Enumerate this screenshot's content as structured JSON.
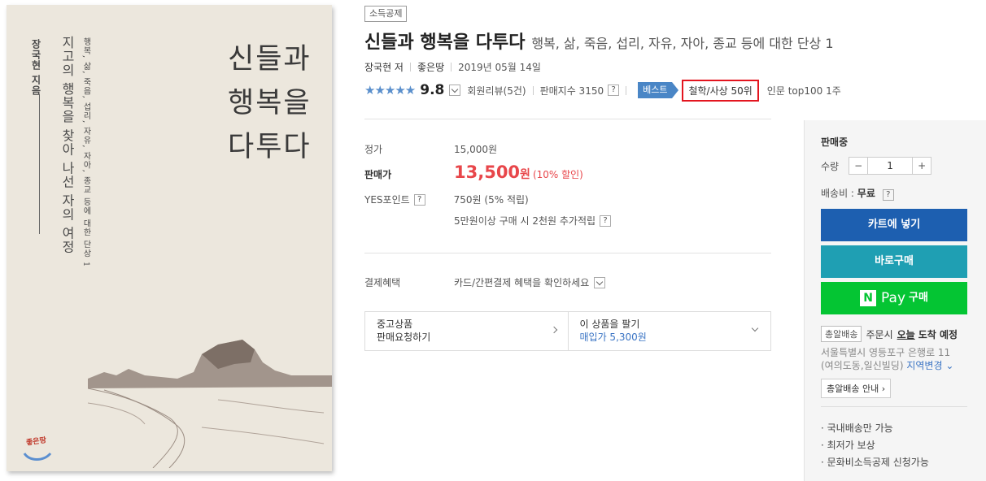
{
  "cover": {
    "title_lines": [
      "신들과",
      "행복을",
      "다투다"
    ],
    "author": "장국현 지음",
    "subtitle": "지고의 행복을 찾아 나선 자의 여정",
    "subtitle2": "행복, 삶, 죽음, 섭리, 자유, 자아, 종교 등에 대한 단상 1",
    "publisher_logo": "좋은땅"
  },
  "tag": "소득공제",
  "title": {
    "main": "신들과 행복을 다투다",
    "sub": "행복, 삶, 죽음, 섭리, 자유, 자아, 종교 등에 대한 단상 1"
  },
  "meta": {
    "author": "장국현 저",
    "publisher": "좋은땅",
    "date": "2019년 05월 14일"
  },
  "rating": {
    "stars": "★★★★★",
    "score": "9.8",
    "reviews": "회원리뷰(5건)",
    "sales_index": "판매지수 3150",
    "best_label": "베스트",
    "rank": "철학/사상 50위",
    "rank2": "인문 top100 1주"
  },
  "price": {
    "list_label": "정가",
    "list_value": "15,000원",
    "sale_label": "판매가",
    "sale_value": "13,500",
    "sale_unit": "원",
    "discount": "(10% 할인)",
    "point_label": "YES포인트",
    "point_value": "750원 (5% 적립)",
    "point_extra": "5만원이상 구매 시 2천원 추가적립"
  },
  "payment": {
    "label": "결제혜택",
    "value": "카드/간편결제 혜택을 확인하세요"
  },
  "used": {
    "left_line1": "중고상품",
    "left_line2": "판매요청하기",
    "right_line1": "이 상품을 팔기",
    "right_line2": "매입가 5,300원"
  },
  "panel": {
    "status": "판매중",
    "qty_label": "수량",
    "qty_value": "1",
    "minus": "−",
    "plus": "+",
    "ship_label": "배송비 : ",
    "ship_value": "무료",
    "cart": "카트에 넣기",
    "buy": "바로구매",
    "npay_n": "N",
    "npay_pay": "Pay",
    "npay_buy": "구매",
    "deliv_badge": "총알배송",
    "deliv_pre": "주문시",
    "deliv_today": "오늘",
    "deliv_post": "도착 예정",
    "addr1": "서울특별시 영등포구 은행로 11",
    "addr2": "(여의도동,일신빌딩)",
    "addr_change": "지역변경",
    "guide": "총알배송 안내",
    "notes": [
      "· 국내배송만 가능",
      "· 최저가 보상",
      "· 문화비소득공제 신청가능"
    ]
  },
  "colors": {
    "sale_red": "#e8464a",
    "rank_box": "#e3151f",
    "cart_blue": "#1d5fb0",
    "buy_teal": "#1f9fb3",
    "npay_green": "#04c533",
    "star_blue": "#5a8fcc"
  }
}
